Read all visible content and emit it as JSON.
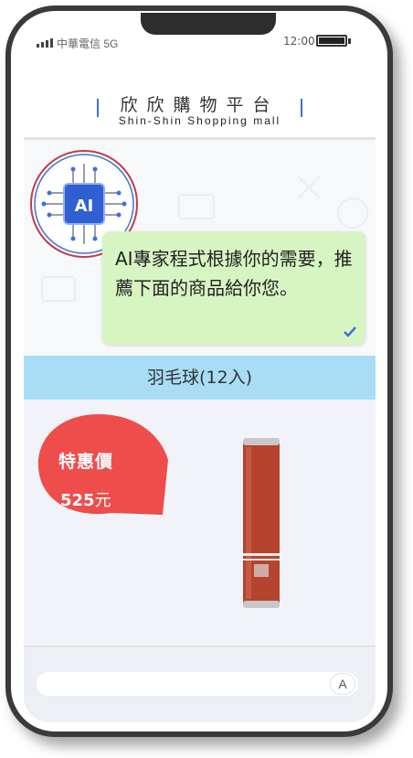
{
  "statusbar": {
    "carrier": "中華電信 5G",
    "time": "12:00"
  },
  "header": {
    "title_zh": "欣欣購物平台",
    "title_en": "Shin-Shin Shopping mall"
  },
  "chat": {
    "avatar_label": "AI",
    "message": "AI專家程式根據你的需要，推薦下面的商品給你您。"
  },
  "product": {
    "name": "羽毛球(12入)",
    "badge_title": "特惠價",
    "price_value": "525",
    "price_unit": "元",
    "carousel": {
      "count": 4,
      "active": 0
    }
  },
  "input": {
    "ime_label": "A"
  },
  "colors": {
    "bubble": "#d7f5c2",
    "product_bar": "#a9ddf6",
    "badge": "#ef4c4c",
    "ai_chip": "#3f6fd8",
    "tube": "#b5432e"
  }
}
